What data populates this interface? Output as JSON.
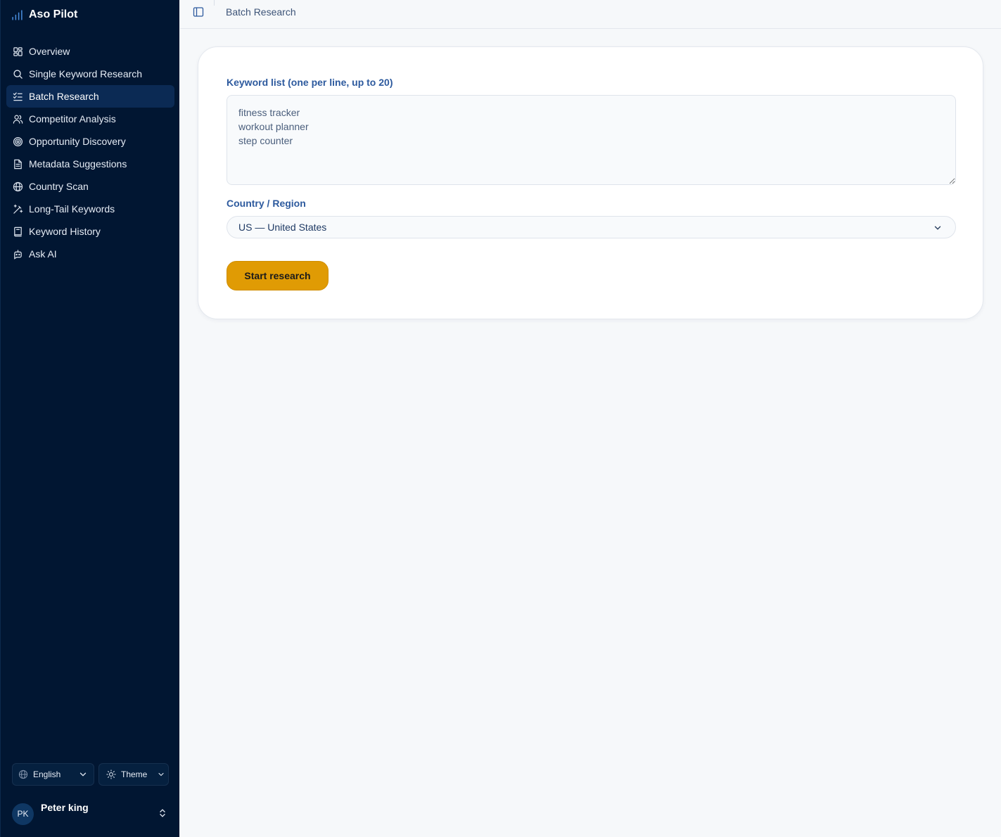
{
  "app": {
    "name": "Aso Pilot"
  },
  "sidebar": {
    "items": [
      {
        "label": "Overview",
        "icon": "grid-icon",
        "active": false
      },
      {
        "label": "Single Keyword Research",
        "icon": "search-icon",
        "active": false
      },
      {
        "label": "Batch Research",
        "icon": "checklist-icon",
        "active": true
      },
      {
        "label": "Competitor Analysis",
        "icon": "users-icon",
        "active": false
      },
      {
        "label": "Opportunity Discovery",
        "icon": "target-icon",
        "active": false
      },
      {
        "label": "Metadata Suggestions",
        "icon": "document-icon",
        "active": false
      },
      {
        "label": "Country Scan",
        "icon": "globe-icon",
        "active": false
      },
      {
        "label": "Long-Tail Keywords",
        "icon": "magic-wand-icon",
        "active": false
      },
      {
        "label": "Keyword History",
        "icon": "book-icon",
        "active": false
      },
      {
        "label": "Ask AI",
        "icon": "bot-icon",
        "active": false
      }
    ],
    "language": "English",
    "theme": "Theme",
    "user": {
      "initials": "PK",
      "name": "Peter king"
    }
  },
  "header": {
    "breadcrumb": "Batch Research"
  },
  "form": {
    "keywords_label": "Keyword list (one per line, up to 20)",
    "keywords_value": "fitness tracker\nworkout planner\nstep counter",
    "country_label": "Country / Region",
    "country_value": "US — United States",
    "submit_label": "Start research"
  },
  "colors": {
    "sidebar_bg": "#011632",
    "active_item_bg": "#0b2a54",
    "label_blue": "#2d5a9e",
    "button_amber": "#e09b04"
  }
}
